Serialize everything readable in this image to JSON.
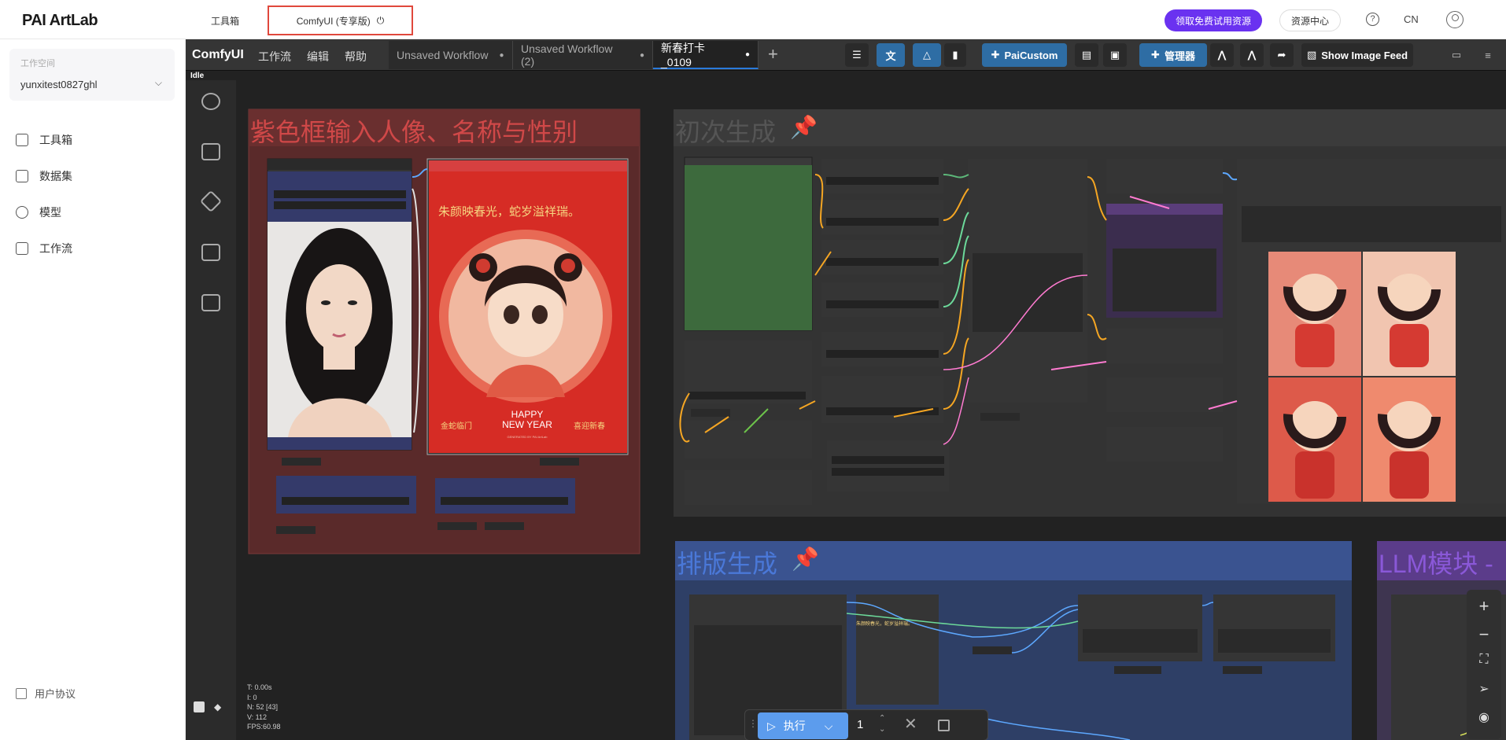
{
  "app": {
    "logo": "PAI ArtLab"
  },
  "topnav": {
    "tabs": [
      {
        "label": "工具箱"
      },
      {
        "label": "ComfyUI (专享版)"
      }
    ],
    "power_icon": "power-icon",
    "trial_button": "领取免费试用资源",
    "resource_button": "资源中心",
    "help_icon": "?",
    "lang": "CN"
  },
  "sidebar": {
    "workspace_label": "工作空间",
    "workspace_name": "yunxitest0827ghl",
    "items": [
      {
        "label": "工具箱",
        "icon": "toolbox-icon"
      },
      {
        "label": "数据集",
        "icon": "dataset-icon"
      },
      {
        "label": "模型",
        "icon": "model-icon"
      },
      {
        "label": "工作流",
        "icon": "workflow-icon"
      }
    ],
    "footer": "用户协议"
  },
  "comfy": {
    "brand": "ComfyUI",
    "menu": [
      "工作流",
      "编辑",
      "帮助"
    ],
    "workflow_tabs": [
      {
        "label": "Unsaved Workflow",
        "marker": "●"
      },
      {
        "label": "Unsaved Workflow (2)",
        "marker": "●"
      },
      {
        "label": "新春打卡_0109",
        "marker": "●"
      }
    ],
    "toolbar": {
      "paicustom": "PaiCustom",
      "manager": "管理器",
      "image_feed": "Show Image Feed"
    },
    "status": "Idle",
    "stats": {
      "t": "T: 0.00s",
      "i": "I: 0",
      "n": "N: 52 [43]",
      "v": "V: 112",
      "fps": "FPS:60.98"
    },
    "groups": {
      "g1_title": "紫色框输入人像、名称与性别",
      "g2_title": "初次生成",
      "g3_title": "排版生成",
      "g4_title": "LLM模块 -"
    },
    "poster": {
      "slogan": "朱颜映春光，蛇岁溢祥瑞。",
      "happy": "HAPPY",
      "new_year": "NEW YEAR",
      "left_text": "金蛇临门",
      "right_text": "喜迎新春",
      "generated": "GENERATED BY PAI ArtLab"
    },
    "text_node": "朱颜映春光，蛇岁溢祥瑞。",
    "run": {
      "label": "执行",
      "count": "1"
    }
  }
}
